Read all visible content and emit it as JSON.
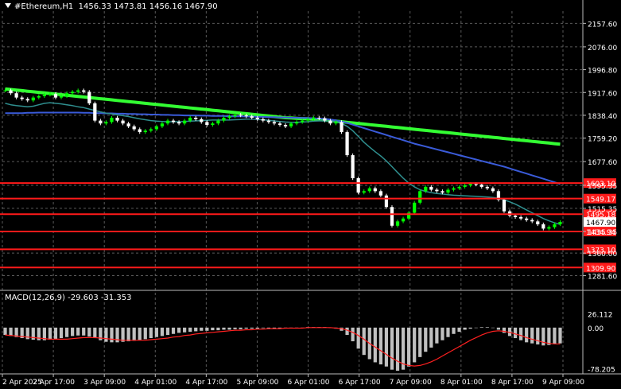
{
  "header": {
    "symbol": "#Ethereum,H1",
    "ohlc": "1456.33 1473.81 1456.16 1467.90"
  },
  "indicator": {
    "label": "MACD(12,26,9) -29.603 -31.353"
  },
  "colors": {
    "background": "#000000",
    "grid": "#5a5a5a",
    "bull_candle": "#00ff00",
    "bear_candle": "#ffffff",
    "sma_fast": "#2f8f8f",
    "sma_mid": "#3a5bd9",
    "sma_slow": "#33ff33",
    "level_line": "#ff1a1a",
    "level_label_bg": "#ff1a1a",
    "current_label_bg": "#ffffff",
    "macd_hist": "#c0c0c0",
    "macd_signal": "#ff2020"
  },
  "chart_data": {
    "type": "line",
    "title": "#Ethereum,H1",
    "ylim": [
      1250,
      2200
    ],
    "price_ticks": [
      "2157.60",
      "2076.00",
      "1996.80",
      "1917.60",
      "1838.40",
      "1759.20",
      "1677.60",
      "1595.35",
      "1515.35",
      "1435.35",
      "1360.00",
      "1281.60"
    ],
    "x_ticks": [
      "2 Apr 2025",
      "2 Apr 17:00",
      "3 Apr 09:00",
      "4 Apr 01:00",
      "4 Apr 17:00",
      "5 Apr 09:00",
      "6 Apr 01:00",
      "6 Apr 17:00",
      "7 Apr 09:00",
      "8 Apr 01:00",
      "8 Apr 17:00",
      "9 Apr 09:00"
    ],
    "levels": [
      {
        "label": "1603.10",
        "value": 1603.1
      },
      {
        "label": "1549.17",
        "value": 1549.17
      },
      {
        "label": "1495.18",
        "value": 1495.18
      },
      {
        "label": "1434.94",
        "value": 1434.94
      },
      {
        "label": "1373.10",
        "value": 1373.1
      },
      {
        "label": "1309.90",
        "value": 1309.9
      }
    ],
    "current_price": {
      "label": "1467.90",
      "value": 1467.9
    },
    "series": [
      {
        "key": "price",
        "values": [
          1925,
          1915,
          1900,
          1895,
          1890,
          1900,
          1905,
          1910,
          1912,
          1900,
          1905,
          1915,
          1920,
          1925,
          1920,
          1880,
          1820,
          1810,
          1815,
          1830,
          1820,
          1810,
          1800,
          1790,
          1780,
          1785,
          1790,
          1800,
          1810,
          1820,
          1815,
          1810,
          1820,
          1830,
          1825,
          1815,
          1805,
          1810,
          1820,
          1830,
          1835,
          1840,
          1838,
          1835,
          1830,
          1825,
          1820,
          1815,
          1810,
          1805,
          1800,
          1810,
          1815,
          1820,
          1825,
          1830,
          1828,
          1820,
          1810,
          1815,
          1780,
          1700,
          1620,
          1570,
          1575,
          1585,
          1575,
          1560,
          1520,
          1455,
          1470,
          1480,
          1500,
          1535,
          1575,
          1590,
          1580,
          1575,
          1570,
          1580,
          1585,
          1590,
          1595,
          1600,
          1598,
          1590,
          1585,
          1575,
          1545,
          1505,
          1490,
          1485,
          1480,
          1475,
          1470,
          1460,
          1445,
          1450,
          1460,
          1468
        ]
      },
      {
        "key": "sma_fast",
        "values": [
          1880,
          1875,
          1872,
          1870,
          1868,
          1870,
          1875,
          1880,
          1882,
          1880,
          1878,
          1875,
          1872,
          1868,
          1865,
          1860,
          1855,
          1850,
          1846,
          1843,
          1840,
          1837,
          1834,
          1830,
          1826,
          1823,
          1820,
          1818,
          1817,
          1816,
          1816,
          1816,
          1817,
          1818,
          1819,
          1820,
          1821,
          1822,
          1822,
          1822,
          1822,
          1823,
          1824,
          1825,
          1825,
          1824,
          1823,
          1821,
          1819,
          1817,
          1815,
          1814,
          1814,
          1815,
          1816,
          1818,
          1819,
          1819,
          1818,
          1815,
          1810,
          1800,
          1785,
          1765,
          1745,
          1728,
          1712,
          1697,
          1680,
          1660,
          1640,
          1620,
          1603,
          1590,
          1580,
          1574,
          1570,
          1567,
          1565,
          1563,
          1561,
          1560,
          1559,
          1558,
          1557,
          1556,
          1555,
          1553,
          1550,
          1545,
          1538,
          1530,
          1520,
          1510,
          1500,
          1490,
          1480,
          1472,
          1465,
          1460
        ]
      },
      {
        "key": "sma_mid",
        "values": [
          1846,
          1846,
          1846,
          1846,
          1847,
          1847,
          1848,
          1848,
          1848,
          1848,
          1848,
          1848,
          1848,
          1848,
          1847,
          1847,
          1846,
          1846,
          1845,
          1845,
          1844,
          1844,
          1843,
          1843,
          1842,
          1842,
          1841,
          1841,
          1840,
          1840,
          1839,
          1839,
          1838,
          1838,
          1838,
          1837,
          1837,
          1836,
          1836,
          1836,
          1835,
          1835,
          1835,
          1834,
          1834,
          1833,
          1833,
          1832,
          1832,
          1831,
          1831,
          1830,
          1830,
          1829,
          1829,
          1828,
          1827,
          1826,
          1824,
          1821,
          1817,
          1812,
          1806,
          1800,
          1794,
          1788,
          1782,
          1776,
          1770,
          1764,
          1758,
          1752,
          1746,
          1740,
          1735,
          1730,
          1725,
          1720,
          1715,
          1710,
          1705,
          1700,
          1695,
          1690,
          1685,
          1680,
          1675,
          1670,
          1665,
          1660,
          1654,
          1648,
          1642,
          1636,
          1630,
          1624,
          1618,
          1612,
          1606,
          1600
        ]
      },
      {
        "key": "sma_slow",
        "values": [
          1930,
          1928,
          1926,
          1924,
          1922,
          1920,
          1918,
          1916,
          1914,
          1912,
          1910,
          1908,
          1906,
          1904,
          1902,
          1900,
          1898,
          1896,
          1894,
          1892,
          1890,
          1888,
          1886,
          1884,
          1882,
          1880,
          1878,
          1876,
          1874,
          1872,
          1870,
          1868,
          1866,
          1864,
          1862,
          1860,
          1858,
          1856,
          1854,
          1852,
          1850,
          1848,
          1846,
          1844,
          1842,
          1840,
          1838,
          1836,
          1834,
          1832,
          1830,
          1829,
          1828,
          1827,
          1826,
          1825,
          1824,
          1822,
          1820,
          1818,
          1816,
          1814,
          1812,
          1810,
          1808,
          1806,
          1804,
          1802,
          1800,
          1798,
          1796,
          1794,
          1792,
          1790,
          1788,
          1786,
          1784,
          1782,
          1780,
          1778,
          1776,
          1774,
          1772,
          1770,
          1768,
          1766,
          1764,
          1762,
          1760,
          1758,
          1756,
          1754,
          1752,
          1750,
          1748,
          1746,
          1744,
          1742,
          1740,
          1738
        ]
      }
    ],
    "macd": {
      "ylim": [
        -85,
        30
      ],
      "ticks": [
        "26.112",
        "0.00",
        "-78.205"
      ],
      "histogram": [
        -14,
        -16,
        -18,
        -20,
        -22,
        -23,
        -24,
        -24,
        -23,
        -22,
        -20,
        -18,
        -16,
        -15,
        -15,
        -17,
        -20,
        -24,
        -27,
        -28,
        -28,
        -27,
        -26,
        -25,
        -24,
        -22,
        -20,
        -18,
        -16,
        -14,
        -12,
        -10,
        -9,
        -8,
        -7,
        -6,
        -6,
        -5,
        -5,
        -4,
        -4,
        -3,
        -3,
        -2,
        -2,
        -2,
        -1,
        -1,
        -1,
        -1,
        -1,
        0,
        0,
        0,
        1,
        1,
        1,
        1,
        0,
        -2,
        -6,
        -14,
        -26,
        -40,
        -52,
        -60,
        -66,
        -70,
        -74,
        -80,
        -82,
        -80,
        -74,
        -66,
        -56,
        -46,
        -38,
        -30,
        -24,
        -18,
        -12,
        -8,
        -4,
        -2,
        0,
        1,
        1,
        0,
        -4,
        -10,
        -16,
        -20,
        -24,
        -28,
        -30,
        -32,
        -34,
        -33,
        -31,
        -30
      ],
      "signal": [
        -14,
        -15,
        -16,
        -17,
        -18,
        -19,
        -20,
        -21,
        -22,
        -22,
        -22,
        -22,
        -21,
        -20,
        -19,
        -19,
        -19,
        -20,
        -21,
        -22,
        -23,
        -24,
        -24,
        -24,
        -24,
        -24,
        -23,
        -22,
        -21,
        -20,
        -18,
        -17,
        -15,
        -14,
        -12,
        -11,
        -10,
        -9,
        -8,
        -7,
        -6,
        -5,
        -5,
        -4,
        -4,
        -3,
        -3,
        -2,
        -2,
        -2,
        -1,
        -1,
        -1,
        -1,
        0,
        0,
        0,
        0,
        0,
        -1,
        -2,
        -5,
        -9,
        -15,
        -22,
        -30,
        -37,
        -44,
        -51,
        -58,
        -64,
        -69,
        -72,
        -73,
        -72,
        -69,
        -65,
        -60,
        -54,
        -48,
        -42,
        -36,
        -30,
        -24,
        -19,
        -14,
        -10,
        -7,
        -6,
        -7,
        -9,
        -12,
        -15,
        -19,
        -22,
        -25,
        -28,
        -30,
        -31,
        -31
      ]
    }
  }
}
